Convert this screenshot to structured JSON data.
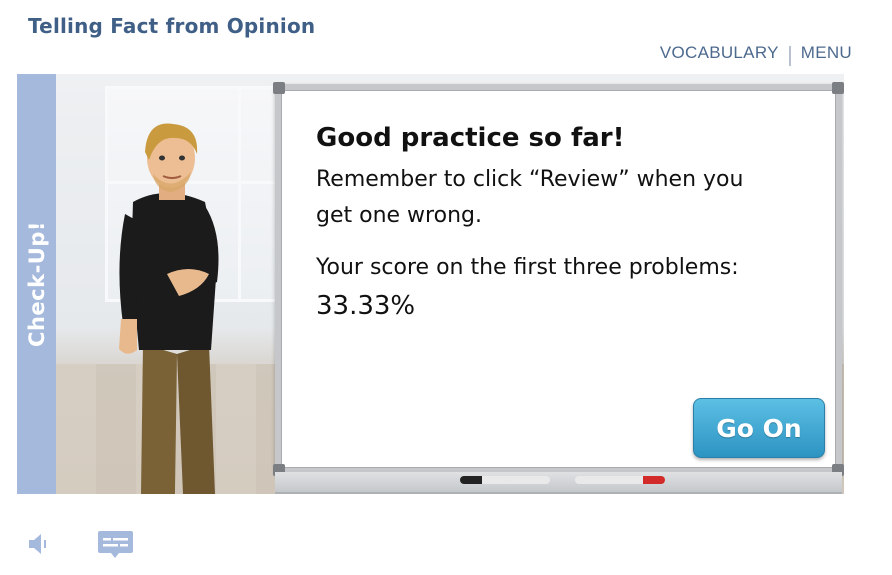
{
  "header": {
    "lesson_title": "Telling Fact from Opinion",
    "nav": {
      "vocabulary": "VOCABULARY",
      "menu": "MENU"
    }
  },
  "side_tab": {
    "label": "Check-Up!"
  },
  "whiteboard": {
    "heading": "Good practice so far!",
    "line1": "Remember to click “Review” when you",
    "line2": "get one wrong.",
    "score_label": "Your score on the first three problems:",
    "score_value": "33.33%"
  },
  "buttons": {
    "go_on": "Go On"
  },
  "icons": {
    "audio": "speaker-icon",
    "captions": "captions-icon"
  },
  "colors": {
    "title": "#3f5f86",
    "side_tab": "#a5b9dd",
    "button": "#2d93c2",
    "icon": "#a5b9dd"
  }
}
